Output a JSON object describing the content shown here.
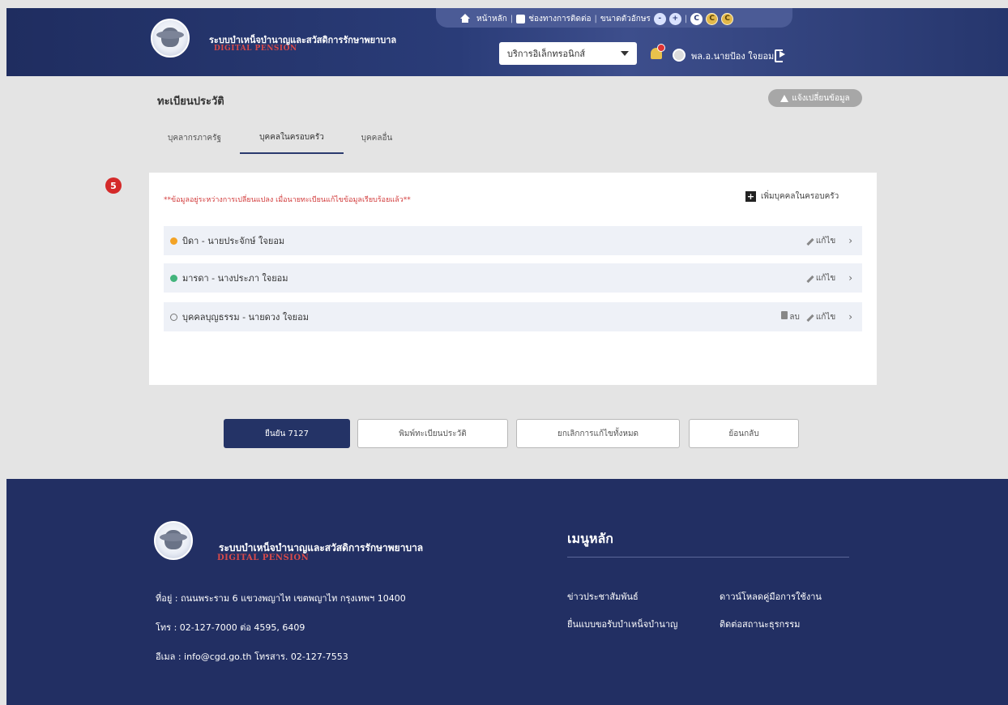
{
  "header": {
    "brand_title": "ระบบบำเหน็จบำนาญและสวัสดิการรักษาพยาบาล",
    "brand_sub": "DIGITAL PENSION",
    "nav": {
      "home": "หน้าหลัก",
      "contact": "ช่องทางการติดต่อ",
      "font_size": "ขนาดตัวอักษร",
      "font_minus": "-",
      "font_plus": "+",
      "contrast_1": "C",
      "contrast_2": "C",
      "contrast_3": "C"
    },
    "service_select": "บริการอิเล็กทรอนิกส์",
    "user_name": "พล.อ.นายป้อง ใจยอม"
  },
  "page": {
    "title": "ทะเบียนประวัติ",
    "notify_button": "แจ้งเปลี่ยนข้อมูล",
    "step_badge": "5",
    "tabs": [
      {
        "label": "บุคลากรภาครัฐ"
      },
      {
        "label": "บุคคลในครอบครัว"
      },
      {
        "label": "บุคคลอื่น"
      }
    ]
  },
  "family": {
    "notice": "**ข้อมูลอยู่ระหว่างการเปลี่ยนแปลง เมื่อนายทะเบียนแก้ไขข้อมูลเรียบร้อยแล้ว**",
    "add_label": "เพิ่มบุคคลในครอบครัว",
    "edit_label": "แก้ไข",
    "delete_label": "ลบ",
    "members": [
      {
        "text": "บิดา - นายประจักษ์ ใจยอม",
        "status_color": "#f3a326"
      },
      {
        "text": "มารดา - นางประภา ใจยอม",
        "status_color": "#43b47c"
      },
      {
        "text": "บุคคลบุญธรรม - นายดวง ใจยอม",
        "status_color": "none"
      }
    ]
  },
  "actions": {
    "submit": "ยืนยัน 7127",
    "print": "พิมพ์ทะเบียนประวัติ",
    "cancel_all": "ยกเลิกการแก้ไขทั้งหมด",
    "back": "ย้อนกลับ"
  },
  "footer": {
    "brand_title": "ระบบบำเหน็จบำนาญและสวัสดิการรักษาพยาบาล",
    "brand_sub": "DIGITAL PENSION",
    "address": "ที่อยู่ : ถนนพระราม 6 แขวงพญาไท เขตพญาไท กรุงเทพฯ 10400",
    "phone": "โทร : 02-127-7000 ต่อ 4595, 6409",
    "email": "อีเมล : info@cgd.go.th โทรสาร. 02-127-7553",
    "menu_title": "เมนูหลัก",
    "links": {
      "news": "ข่าวประชาสัมพันธ์",
      "manual": "ดาวน์โหลดคู่มือการใช้งาน",
      "forms": "ยื่นแบบขอรับบำเหน็จบำนาญ",
      "contact": "ติดต่อสถานะธุรกรรม"
    }
  },
  "colors": {
    "header_bg": "#1f2d60",
    "footer_bg": "#222f63",
    "primary_button": "#243366",
    "notice_red": "#d23b3b",
    "badge_red": "#d42a2a"
  }
}
